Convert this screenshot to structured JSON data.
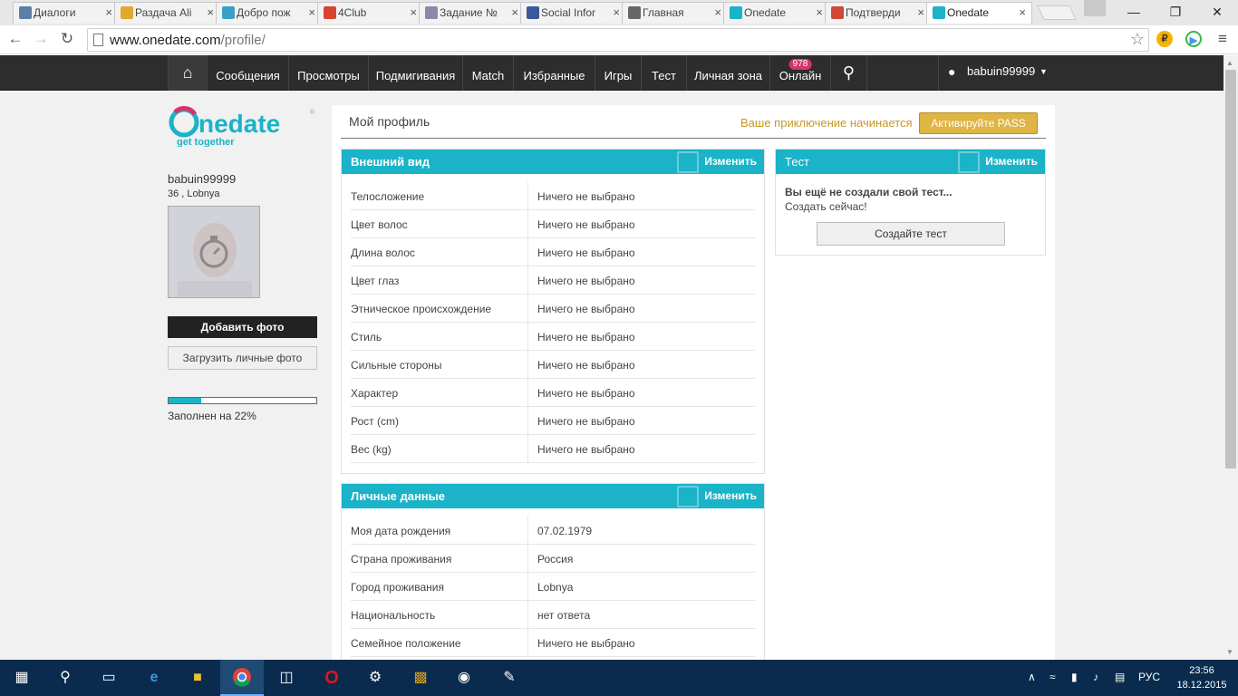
{
  "browser": {
    "tabs": [
      {
        "label": "Диалоги",
        "favicon_color": "#5b7fa6",
        "active": false
      },
      {
        "label": "Раздача Ali",
        "favicon_color": "#e0a82e",
        "active": false
      },
      {
        "label": "Добро пож",
        "favicon_color": "#3aa0c8",
        "active": false
      },
      {
        "label": "4Club",
        "favicon_color": "#d9442e",
        "active": false
      },
      {
        "label": "Задание №",
        "favicon_color": "#8a8aa8",
        "active": false
      },
      {
        "label": "Social Infor",
        "favicon_color": "#3b5998",
        "active": false
      },
      {
        "label": "Главная",
        "favicon_color": "#666666",
        "active": false
      },
      {
        "label": "Onedate",
        "favicon_color": "#1ab3c8",
        "active": false
      },
      {
        "label": "Подтверди",
        "favicon_color": "#d14836",
        "active": false
      },
      {
        "label": "Onedate",
        "favicon_color": "#1ab3c8",
        "active": true
      }
    ],
    "url_host": "www.onedate.com",
    "url_path": "/profile/"
  },
  "nav": {
    "items": [
      "Сообщения",
      "Просмотры",
      "Подмигивания",
      "Match",
      "Избранные",
      "Игры",
      "Тест",
      "Личная зона",
      "Онлайн"
    ],
    "online_count": "978",
    "username": "babuin99999"
  },
  "sidebar": {
    "username": "babuin99999",
    "info": "36 , Lobnya",
    "add_photo": "Добавить фото",
    "upload_private": "Загрузить личные фото",
    "progress_percent": 22,
    "progress_label": "Заполнен на 22%"
  },
  "main": {
    "title": "Мой профиль",
    "adventure_text": "Ваше приключение начинается",
    "pass_button": "Активируйте PASS",
    "appearance": {
      "title": "Внешний вид",
      "edit": "Изменить",
      "rows": [
        {
          "k": "Телосложение",
          "v": "Ничего не выбрано"
        },
        {
          "k": "Цвет волос",
          "v": "Ничего не выбрано"
        },
        {
          "k": "Длина волос",
          "v": "Ничего не выбрано"
        },
        {
          "k": "Цвет глаз",
          "v": "Ничего не выбрано"
        },
        {
          "k": "Этническое происхождение",
          "v": "Ничего не выбрано"
        },
        {
          "k": "Стиль",
          "v": "Ничего не выбрано"
        },
        {
          "k": "Сильные стороны",
          "v": "Ничего не выбрано"
        },
        {
          "k": "Характер",
          "v": "Ничего не выбрано"
        },
        {
          "k": "Рост (cm)",
          "v": "Ничего не выбрано"
        },
        {
          "k": "Вес (kg)",
          "v": "Ничего не выбрано"
        }
      ]
    },
    "personal": {
      "title": "Личные данные",
      "edit": "Изменить",
      "rows": [
        {
          "k": "Моя дата рождения",
          "v": "07.02.1979"
        },
        {
          "k": "Страна проживания",
          "v": "Россия"
        },
        {
          "k": "Город проживания",
          "v": "Lobnya"
        },
        {
          "k": "Национальность",
          "v": "нет ответа"
        },
        {
          "k": "Семейное положение",
          "v": "Ничего не выбрано"
        }
      ]
    },
    "test": {
      "title": "Тест",
      "edit": "Изменить",
      "empty_bold": "Вы ещё не создали свой тест...",
      "empty_sub": "Создать сейчас!",
      "create_button": "Создайте тест"
    }
  },
  "taskbar": {
    "lang": "РУС",
    "time": "23:56",
    "date": "18.12.2015"
  },
  "colors": {
    "accent": "#1ab3c8",
    "pass": "#dfb544",
    "nav_bg": "#2d2d2d",
    "badge": "#d6336c"
  }
}
